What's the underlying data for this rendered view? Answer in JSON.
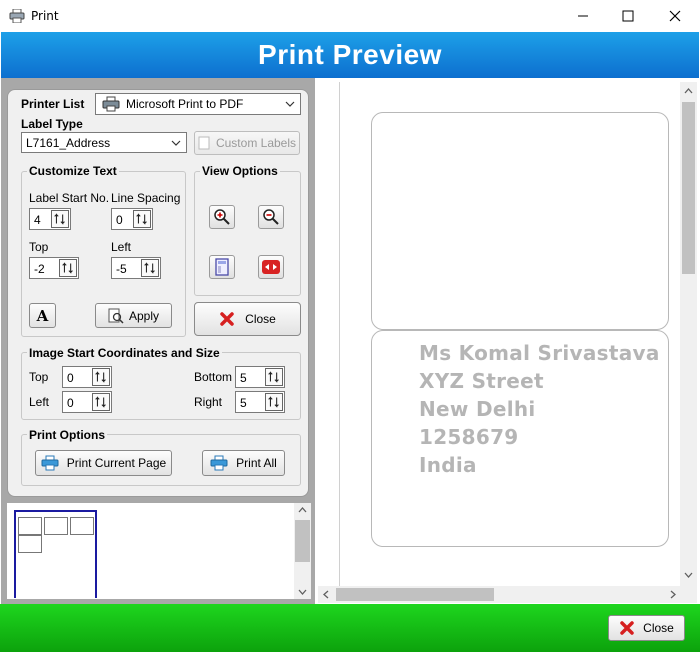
{
  "window": {
    "title": "Print"
  },
  "banner": {
    "title": "Print Preview"
  },
  "printer": {
    "label": "Printer List",
    "selected": "Microsoft Print to PDF"
  },
  "label_type": {
    "label": "Label Type",
    "selected": "L7161_Address",
    "custom_labels_button": "Custom Labels"
  },
  "customize_text": {
    "title": "Customize Text",
    "label_start_no": {
      "label": "Label Start No.",
      "value": "4"
    },
    "line_spacing": {
      "label": "Line Spacing",
      "value": "0"
    },
    "top": {
      "label": "Top",
      "value": "-2"
    },
    "left": {
      "label": "Left",
      "value": "-5"
    },
    "apply_button": "Apply"
  },
  "view_options": {
    "title": "View Options",
    "close_button": "Close"
  },
  "image_coords": {
    "title": "Image Start Coordinates and Size",
    "top": {
      "label": "Top",
      "value": "0"
    },
    "left": {
      "label": "Left",
      "value": "0"
    },
    "bottom": {
      "label": "Bottom",
      "value": "5"
    },
    "right": {
      "label": "Right",
      "value": "5"
    }
  },
  "print_options": {
    "title": "Print Options",
    "print_current_page": "Print Current Page",
    "print_all": "Print All"
  },
  "preview": {
    "address_lines": [
      "Ms Komal Srivastava",
      "XYZ Street",
      "New Delhi",
      "1258679",
      "India"
    ]
  },
  "footer": {
    "close_button": "Close"
  },
  "colors": {
    "banner": "#1188dd",
    "footer": "#14c414",
    "thumbnail_border": "#1a1aa0"
  }
}
